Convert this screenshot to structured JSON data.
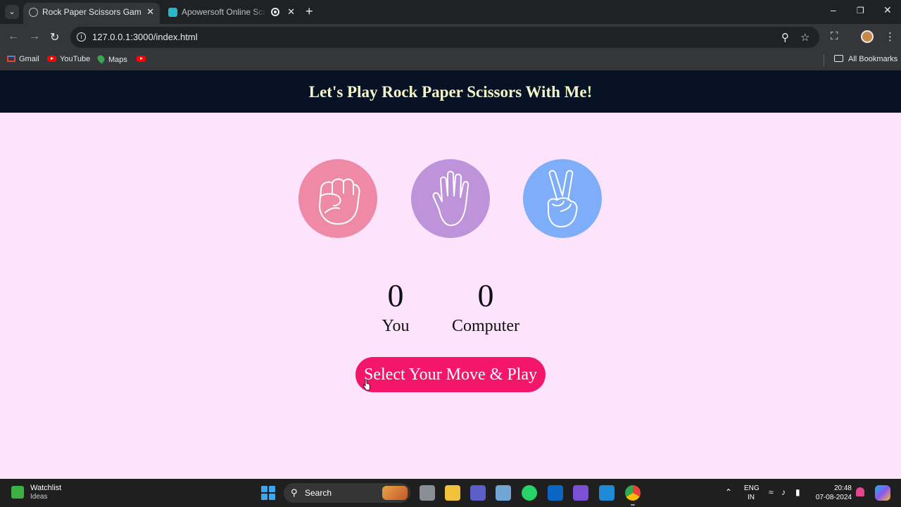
{
  "browser": {
    "tabs": [
      {
        "title": "Rock Paper Scissors Game",
        "active": true
      },
      {
        "title": "Apowersoft Online Screen R",
        "active": false
      }
    ],
    "url": "127.0.0.1:3000/index.html",
    "bookmarks": [
      {
        "label": "Gmail",
        "icon": "gmail-icon"
      },
      {
        "label": "YouTube",
        "icon": "youtube-icon"
      },
      {
        "label": "Maps",
        "icon": "maps-icon"
      },
      {
        "label": "",
        "icon": "youtube-icon"
      }
    ],
    "all_bookmarks_label": "All Bookmarks"
  },
  "game": {
    "title": "Let's Play Rock Paper Scissors With Me!",
    "choices": [
      {
        "id": "rock",
        "icon": "rock-fist-icon",
        "color": "#ee8aa5"
      },
      {
        "id": "paper",
        "icon": "paper-hand-icon",
        "color": "#bf93d9"
      },
      {
        "id": "scissors",
        "icon": "scissors-hand-icon",
        "color": "#7eaefa"
      }
    ],
    "score": {
      "user": {
        "value": "0",
        "label": "You"
      },
      "computer": {
        "value": "0",
        "label": "Computer"
      }
    },
    "message": "Select Your Move & Play"
  },
  "taskbar": {
    "widget_title": "Watchlist",
    "widget_subtitle": "Ideas",
    "search_label": "Search",
    "language_line1": "ENG",
    "language_line2": "IN",
    "time": "20:48",
    "date": "07-08-2024"
  },
  "colors": {
    "banner_bg": "#081225",
    "banner_text": "#f5f7c8",
    "page_bg": "#fde4fc",
    "message_bg": "#f3166a"
  }
}
